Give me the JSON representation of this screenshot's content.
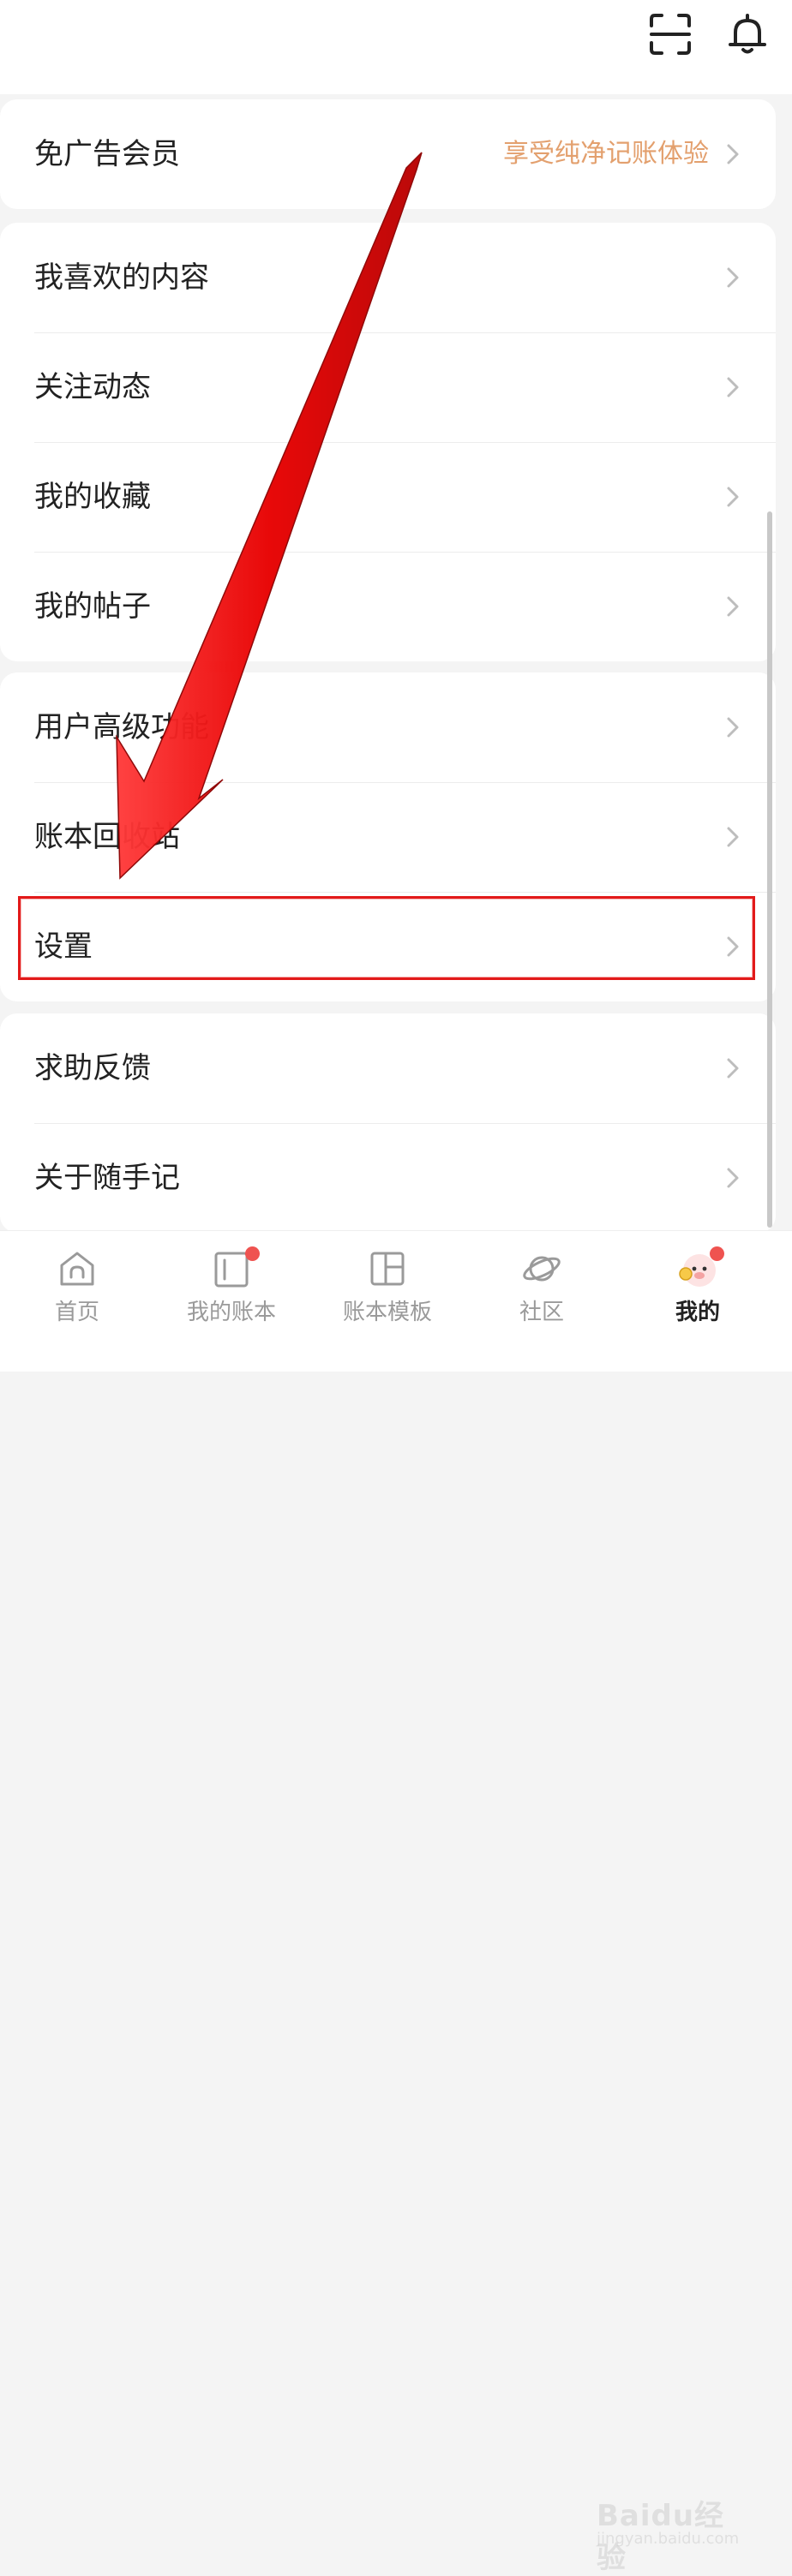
{
  "header": {
    "scan_icon": "scan-icon",
    "bell_icon": "bell-icon"
  },
  "groups": [
    {
      "items": [
        {
          "label": "免广告会员",
          "sub": "享受纯净记账体验"
        }
      ]
    },
    {
      "items": [
        {
          "label": "我喜欢的内容"
        },
        {
          "label": "关注动态"
        },
        {
          "label": "我的收藏"
        },
        {
          "label": "我的帖子"
        }
      ]
    },
    {
      "items": [
        {
          "label": "用户高级功能"
        },
        {
          "label": "账本回收站"
        },
        {
          "label": "设置"
        }
      ]
    },
    {
      "items": [
        {
          "label": "求助反馈"
        },
        {
          "label": "关于随手记"
        }
      ]
    }
  ],
  "tabbar": {
    "tabs": [
      {
        "label": "首页",
        "icon": "home-icon"
      },
      {
        "label": "我的账本",
        "icon": "ledger-icon",
        "badge": true
      },
      {
        "label": "账本模板",
        "icon": "template-icon"
      },
      {
        "label": "社区",
        "icon": "planet-icon"
      },
      {
        "label": "我的",
        "icon": "avatar-icon",
        "badge": true,
        "active": true
      }
    ]
  },
  "watermark": {
    "text": "Baidu经验",
    "sub": "jingyan.baidu.com"
  },
  "colors": {
    "accent": "#e3a06e",
    "badge": "#ef5350",
    "annotation": "#e21a1a"
  }
}
